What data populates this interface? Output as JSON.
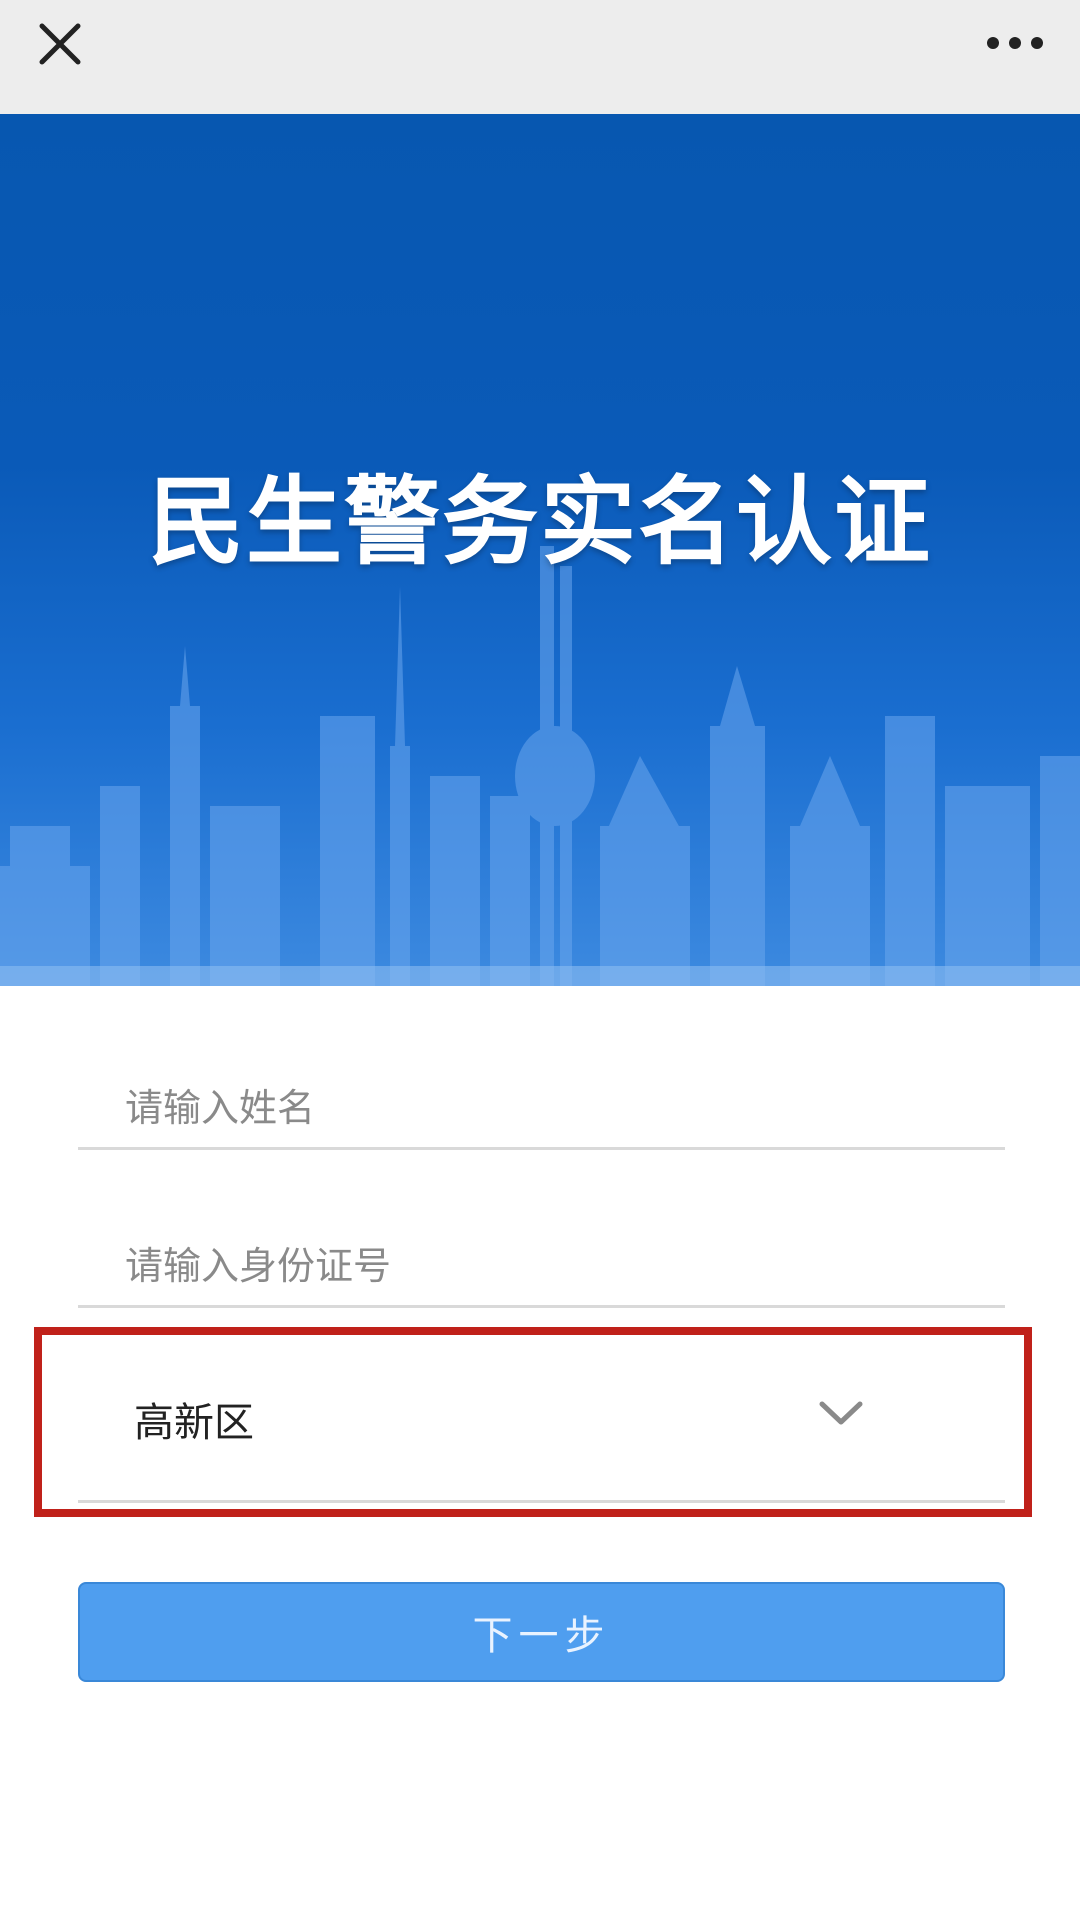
{
  "nav": {
    "close_icon": "close-icon",
    "more_icon": "more-dots-icon"
  },
  "banner": {
    "title": "民生警务实名认证"
  },
  "form": {
    "name_placeholder": "请输入姓名",
    "id_placeholder": "请输入身份证号",
    "district_value": "高新区",
    "submit_label": "下一步"
  },
  "colors": {
    "banner_blue": "#0757b0",
    "button_blue": "#4f9eef",
    "highlight_red": "#c0211a"
  }
}
